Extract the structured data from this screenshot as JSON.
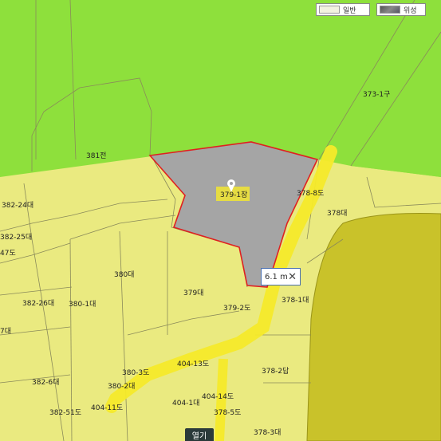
{
  "toolbar": {
    "general_label": "일반",
    "satellite_label": "위성"
  },
  "measure": {
    "value": "6.1 m",
    "close_symbol": "✕"
  },
  "highlight": {
    "label": "379-1장"
  },
  "badge": {
    "label": "열기"
  },
  "colors": {
    "forest": "#8ee03c",
    "field": "#eaea80",
    "olive": "#c9c22a",
    "selected": "#a5a5a5",
    "outline": "#e02020",
    "road": "#f6ea2a"
  },
  "parcels": {
    "p381": "381전",
    "p3731": "373-1구",
    "p37911": "379-1장",
    "p3788": "378-8도",
    "p378": "378대",
    "p38224": "382-24대",
    "p38225": "382-25대",
    "p47": "47도",
    "p380": "380대",
    "p379": "379대",
    "p38226": "382-26대",
    "p3801": "380-1대",
    "p3792": "379-2도",
    "p3781": "378-1대",
    "p7": "7대",
    "p40413": "404-13도",
    "p3803": "380-3도",
    "p3782": "378-2답",
    "p3826": "382-6대",
    "p3802": "380-2대",
    "p40414": "404-14도",
    "p4041": "404-1대",
    "p40411": "404-11도",
    "p38251": "382-51도",
    "p3785": "378-5도",
    "p3783": "378-3대"
  }
}
